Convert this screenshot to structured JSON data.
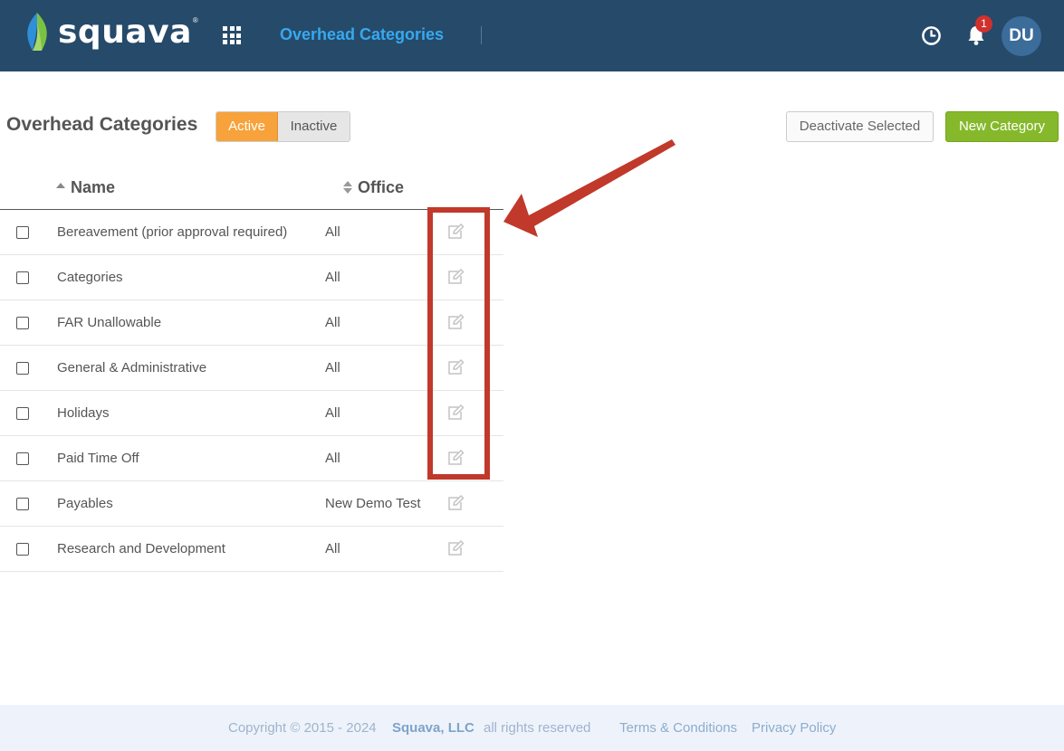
{
  "header": {
    "brand": "squava",
    "brand_mark": "®",
    "title": "Overhead Categories",
    "notification_count": "1",
    "avatar_initials": "DU"
  },
  "toolbar": {
    "page_title": "Overhead Categories",
    "tabs": {
      "active": "Active",
      "inactive": "Inactive"
    },
    "deactivate_label": "Deactivate Selected",
    "new_label": "New Category"
  },
  "table": {
    "columns": {
      "name": "Name",
      "office": "Office"
    },
    "rows": [
      {
        "name": "Bereavement (prior approval required)",
        "office": "All"
      },
      {
        "name": "Categories",
        "office": "All"
      },
      {
        "name": "FAR Unallowable",
        "office": "All"
      },
      {
        "name": "General & Administrative",
        "office": "All"
      },
      {
        "name": "Holidays",
        "office": "All"
      },
      {
        "name": "Paid Time Off",
        "office": "All"
      },
      {
        "name": "Payables",
        "office": "New Demo Test"
      },
      {
        "name": "Research and Development",
        "office": "All"
      }
    ]
  },
  "footer": {
    "copyright": "Copyright © 2015 - 2024",
    "company": "Squava, LLC",
    "rights": "all rights reserved",
    "terms": "Terms & Conditions",
    "privacy": "Privacy Policy"
  },
  "colors": {
    "header_bg": "#264a6a",
    "accent_blue": "#36a9ef",
    "active_orange": "#f7a23b",
    "new_green": "#85b92b",
    "annotation_red": "#c0392b"
  }
}
